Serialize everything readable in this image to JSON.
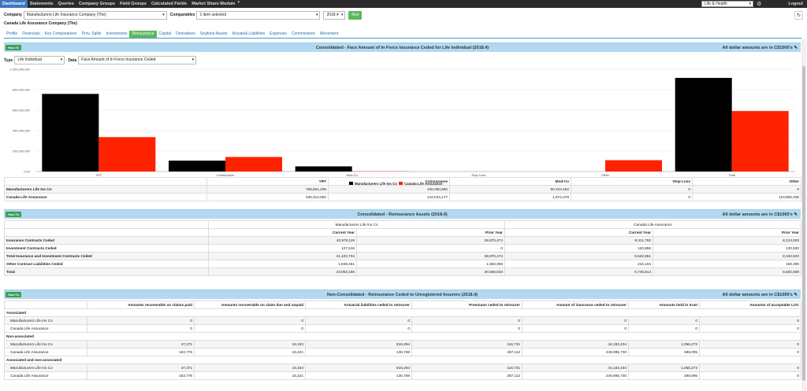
{
  "nav": {
    "items": [
      "Dashboard",
      "Statements",
      "Queries",
      "Company Groups",
      "Field Groups",
      "Calculated Fields",
      "Market Share Module"
    ],
    "dropdown_items": [
      "Market Share Module"
    ],
    "industry": "Life & Health",
    "logout": "Logout"
  },
  "filters": {
    "company_label": "Company",
    "company_value": "Manufacturers Life Insurance Company (The)",
    "comparables_label": "Comparables",
    "comparables_value": "1 item selected",
    "period_value": "2018.4",
    "run_label": "Run"
  },
  "company_name": "Canada Life Assurance Company (The)",
  "tabs": [
    "Profile",
    "Financials",
    "Key Comparatives",
    "Prov. Splits",
    "Investments",
    "Reinsurance",
    "Capital",
    "Derivatives",
    "Segfund Assets",
    "Actuarial Liabilities",
    "Expenses",
    "Commissions",
    "Movement"
  ],
  "active_tab": "Reinsurance",
  "howto": "How To",
  "section1": {
    "title": "Consolidated - Face Amount of In Force Insurance Ceded for Life Individual (2018.4)",
    "note": "All dollar amounts are in C$1000's",
    "type_label": "Type",
    "type_value": "Life Individual",
    "data_label": "Data",
    "data_value": "Face Amount of In Force Insurance Ceded",
    "table": {
      "headers": [
        "",
        "YRT",
        "Coinsurance",
        "Mod-Co",
        "Stop Loss",
        "Other",
        "Total"
      ],
      "rows": [
        [
          "Manufacturers Life Ins Co",
          "758,851,206",
          "106,050,582",
          "50,323,462",
          "0",
          "0",
          "915,225,250"
        ],
        [
          "Canada Life Assurance",
          "336,313,693",
          "142,034,177",
          "1,974,478",
          "0",
          "110,805,336",
          "591,127,683"
        ]
      ]
    }
  },
  "chart_data": {
    "type": "bar",
    "categories": [
      "YRT",
      "Coinsurance",
      "Mod-Co",
      "Stop Loss",
      "Other",
      "Total"
    ],
    "series": [
      {
        "name": "Manufacturers Life Ins Co",
        "values": [
          758851206,
          106050582,
          50323462,
          0,
          0,
          915225250
        ],
        "color": "#000000"
      },
      {
        "name": "Canada Life Assurance",
        "values": [
          336313693,
          142034177,
          1974478,
          0,
          110805336,
          591127683
        ],
        "color": "#ff2200"
      }
    ],
    "yticks": [
      "0.00",
      "200,000,000",
      "400,000,000",
      "600,000,000",
      "800,000,000",
      "1,000,000,000"
    ],
    "ylim": [
      0,
      1000000000
    ],
    "legend": "bottom-center",
    "grid": true
  },
  "section2": {
    "title": "Consolidated - Reinsurance Assets (2018.4)",
    "note": "All dollar amounts are in C$1000's",
    "groups": [
      "Manufacturers Life Ins Co",
      "Canada Life Assurance"
    ],
    "subheaders": [
      "Current Year",
      "Prior Year",
      "Current Year",
      "Prior Year"
    ],
    "rows": [
      [
        "Insurance Contracts Ceded",
        "40,976,119",
        "28,875,474",
        "9,411,782",
        "8,213,003"
      ],
      [
        "Investment Contracts Ceded",
        "127,616",
        "0",
        "120,869",
        "130,530"
      ],
      [
        "Total Insurance and Investment Contracts Ceded",
        "41,103,734",
        "28,875,474",
        "9,532,651",
        "8,343,533"
      ],
      [
        "Other Contract Liabilities Ceded",
        "1,949,451",
        "1,683,059",
        "216,163",
        "159,306"
      ],
      [
        "Total",
        "43,053,185",
        "30,558,533",
        "9,748,814",
        "8,502,839"
      ]
    ]
  },
  "section3": {
    "title": "Non-Consolidated - Reinsurance Ceded to Unregistered Insurers (2018.4)",
    "note": "All dollar amounts are in C$1000's",
    "headers": [
      "",
      "Amounts recoverable on claims paid",
      "Amounts recoverable on claim due and unpaid",
      "Actuarial liabilities ceded to reinsurer",
      "Premiums ceded to reinsurer",
      "Amount of insurance ceded to reinsurer",
      "Amounts held in trust",
      "Amounts of acceptable LOC"
    ],
    "groups": [
      {
        "name": "Associated",
        "rows": [
          [
            "Manufacturers Life Ins Co",
            "0",
            "0",
            "0",
            "0",
            "0",
            "0",
            "0"
          ],
          [
            "Canada Life Assurance",
            "0",
            "0",
            "0",
            "0",
            "0",
            "0",
            "0"
          ]
        ]
      },
      {
        "name": "Non-associated",
        "rows": [
          [
            "Manufacturers Life Ins Co",
            "47,371",
            "16,343",
            "816,294",
            "116,731",
            "44,183,434",
            "1,056,273",
            "0"
          ],
          [
            "Canada Life Assurance",
            "163,776",
            "15,221",
            "136,769",
            "287,112",
            "249,985,730",
            "298,095",
            "0"
          ]
        ]
      },
      {
        "name": "Associated and non-associated",
        "rows": [
          [
            "Manufacturers Life Ins Co",
            "47,371",
            "16,343",
            "816,294",
            "116,731",
            "44,183,434",
            "1,056,273",
            "0"
          ],
          [
            "Canada Life Assurance",
            "163,776",
            "15,221",
            "136,769",
            "287,112",
            "249,985,730",
            "298,095",
            "0"
          ]
        ]
      }
    ]
  }
}
